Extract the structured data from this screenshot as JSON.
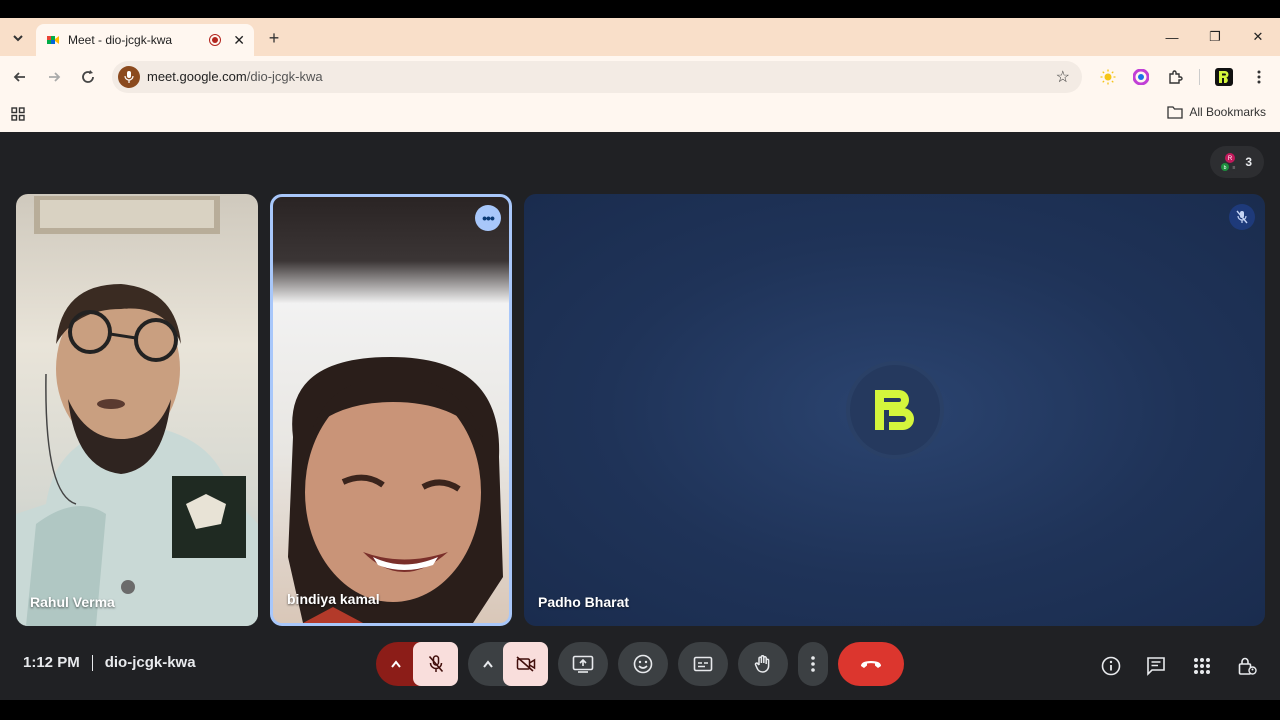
{
  "browser": {
    "tab": {
      "title": "Meet - dio-jcgk-kwa"
    },
    "new_tab": "+",
    "window": {
      "minimize": "—",
      "restore": "❐",
      "close": "✕"
    },
    "address": {
      "host": "meet.google.com",
      "path": "/dio-jcgk-kwa"
    },
    "bookmarks": {
      "all_bookmarks": "All Bookmarks"
    }
  },
  "meet": {
    "participants_count": "3",
    "tiles": [
      {
        "name": "Rahul Verma"
      },
      {
        "name": "bindiya kamal"
      },
      {
        "name": "Padho Bharat"
      }
    ],
    "bottom_bar": {
      "time": "1:12 PM",
      "meeting_code": "dio-jcgk-kwa"
    }
  },
  "colors": {
    "tabstrip_bg": "#f9dfc9",
    "meet_bg": "#202124",
    "hangup_red": "#dc362e",
    "muted_pink": "#f9dedc",
    "muted_dark_red": "#8c1d18",
    "logo_lime": "#d4f53c",
    "active_tile_border": "#a8c7fa"
  }
}
